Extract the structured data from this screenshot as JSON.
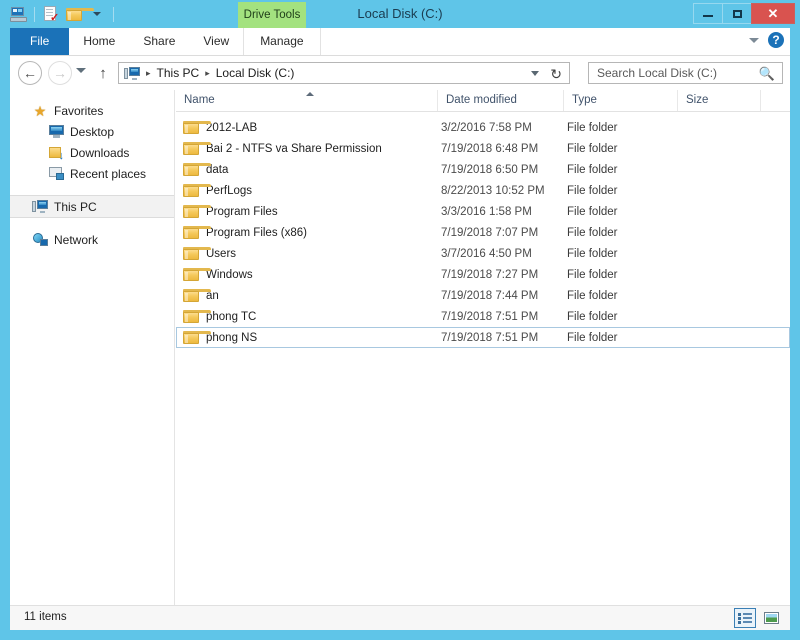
{
  "window": {
    "title": "Local Disk (C:)",
    "minimize_label": "Minimize",
    "maximize_label": "Maximize",
    "close_label": "✕"
  },
  "quick_access": {
    "drive_icon": "drive-icon",
    "properties_icon": "properties-icon",
    "new_folder_icon": "new-folder-icon",
    "customize_icon": "chevron-down-icon"
  },
  "ribbon": {
    "contextual_tab": "Drive Tools",
    "tabs": [
      {
        "label": "File",
        "id": "file"
      },
      {
        "label": "Home",
        "id": "home"
      },
      {
        "label": "Share",
        "id": "share"
      },
      {
        "label": "View",
        "id": "view"
      },
      {
        "label": "Manage",
        "id": "manage"
      }
    ],
    "expand_icon": "chevron-down-icon",
    "help_label": "?"
  },
  "navbar": {
    "back_label": "←",
    "forward_label": "→",
    "recent_label": "recent-locations",
    "up_label": "↑",
    "breadcrumbs": [
      {
        "label": "This PC"
      },
      {
        "label": "Local Disk (C:)"
      }
    ],
    "separator": "▸",
    "refresh_label": "↻"
  },
  "search": {
    "placeholder": "Search Local Disk (C:)",
    "value": "",
    "icon": "search-icon"
  },
  "sidebar": {
    "items": [
      {
        "label": "Favorites",
        "icon": "star-icon",
        "level": 1,
        "selected": false
      },
      {
        "label": "Desktop",
        "icon": "desktop-icon",
        "level": 2,
        "selected": false
      },
      {
        "label": "Downloads",
        "icon": "downloads-icon",
        "level": 2,
        "selected": false
      },
      {
        "label": "Recent places",
        "icon": "recent-places-icon",
        "level": 2,
        "selected": false
      },
      {
        "label": "This PC",
        "icon": "this-pc-icon",
        "level": 1,
        "selected": true
      },
      {
        "label": "Network",
        "icon": "network-icon",
        "level": 1,
        "selected": false
      }
    ]
  },
  "file_list": {
    "columns": [
      {
        "label": "Name",
        "key": "name"
      },
      {
        "label": "Date modified",
        "key": "date"
      },
      {
        "label": "Type",
        "key": "type"
      },
      {
        "label": "Size",
        "key": "size"
      }
    ],
    "sort_column": "Name",
    "sort_direction": "ascending",
    "rows": [
      {
        "name": "2012-LAB",
        "date": "3/2/2016 7:58 PM",
        "type": "File folder",
        "size": "",
        "icon": "folder-icon",
        "focused": false
      },
      {
        "name": "Bai 2 - NTFS va Share Permission",
        "date": "7/19/2018 6:48 PM",
        "type": "File folder",
        "size": "",
        "icon": "folder-icon",
        "focused": false
      },
      {
        "name": "data",
        "date": "7/19/2018 6:50 PM",
        "type": "File folder",
        "size": "",
        "icon": "folder-icon",
        "focused": false
      },
      {
        "name": "PerfLogs",
        "date": "8/22/2013 10:52 PM",
        "type": "File folder",
        "size": "",
        "icon": "folder-icon",
        "focused": false
      },
      {
        "name": "Program Files",
        "date": "3/3/2016 1:58 PM",
        "type": "File folder",
        "size": "",
        "icon": "folder-icon",
        "focused": false
      },
      {
        "name": "Program Files (x86)",
        "date": "7/19/2018 7:07 PM",
        "type": "File folder",
        "size": "",
        "icon": "folder-icon",
        "focused": false
      },
      {
        "name": "Users",
        "date": "3/7/2016 4:50 PM",
        "type": "File folder",
        "size": "",
        "icon": "folder-icon",
        "focused": false
      },
      {
        "name": "Windows",
        "date": "7/19/2018 7:27 PM",
        "type": "File folder",
        "size": "",
        "icon": "folder-icon",
        "focused": false
      },
      {
        "name": "an",
        "date": "7/19/2018 7:44 PM",
        "type": "File folder",
        "size": "",
        "icon": "folder-icon",
        "focused": false
      },
      {
        "name": "phong TC",
        "date": "7/19/2018 7:51 PM",
        "type": "File folder",
        "size": "",
        "icon": "folder-icon",
        "focused": false
      },
      {
        "name": "phong NS",
        "date": "7/19/2018 7:51 PM",
        "type": "File folder",
        "size": "",
        "icon": "folder-icon",
        "focused": true
      }
    ]
  },
  "status_bar": {
    "item_count": "11 items",
    "views": [
      {
        "name": "details-view",
        "icon": "details-view-icon",
        "active": true
      },
      {
        "name": "large-icons-view",
        "icon": "large-icons-view-icon",
        "active": false
      }
    ]
  },
  "colors": {
    "title_bar": "#5fc5e8",
    "file_tab": "#1b72b8",
    "contextual_tab": "#a3e27f",
    "close_button": "#d9534f",
    "folder": "#edb93f"
  }
}
